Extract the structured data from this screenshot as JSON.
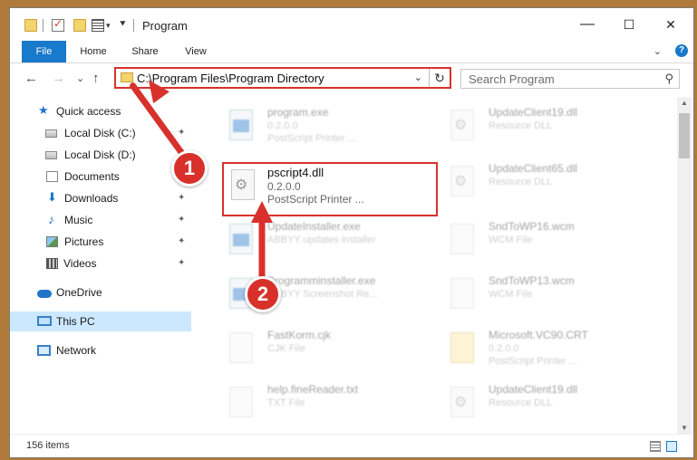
{
  "window": {
    "title": "Program",
    "controls": {
      "minimize": "—",
      "maximize": "☐",
      "close": "✕"
    }
  },
  "ribbon": {
    "tabs": [
      "File",
      "Home",
      "Share",
      "View"
    ],
    "collapse_glyph": "⌄",
    "help_glyph": "?"
  },
  "navigation": {
    "back_glyph": "←",
    "forward_glyph": "→",
    "recent_glyph": "⌄",
    "up_glyph": "↑",
    "address": "C:\\Program Files\\Program Directory",
    "dropdown_glyph": "⌄",
    "refresh_glyph": "↻",
    "search_placeholder": "Search Program",
    "search_glyph": "⚲"
  },
  "sidebar": {
    "items": [
      {
        "label": "Quick access",
        "icon": "star-icon"
      },
      {
        "label": "Local Disk (C:)",
        "icon": "drive-icon",
        "pinned": true
      },
      {
        "label": "Local Disk (D:)",
        "icon": "drive-icon",
        "pinned": true
      },
      {
        "label": "Documents",
        "icon": "documents-icon",
        "pinned": true
      },
      {
        "label": "Downloads",
        "icon": "download-icon",
        "pinned": true
      },
      {
        "label": "Music",
        "icon": "music-icon",
        "pinned": true
      },
      {
        "label": "Pictures",
        "icon": "pictures-icon",
        "pinned": true
      },
      {
        "label": "Videos",
        "icon": "videos-icon",
        "pinned": true
      },
      {
        "label": "OneDrive",
        "icon": "cloud-icon"
      },
      {
        "label": "This PC",
        "icon": "computer-icon",
        "selected": true
      },
      {
        "label": "Network",
        "icon": "network-icon"
      }
    ],
    "pin_glyph": "📌"
  },
  "files": [
    {
      "name": "program.exe",
      "line1": "0.2.0.0",
      "line2": "PostScript Printer ...",
      "icon": "exe-icon"
    },
    {
      "name": "UpdateClient19.dll",
      "line1": "Resource DLL",
      "line2": "",
      "icon": "dll-icon"
    },
    {
      "name": "pscript4.dll",
      "line1": "0.2.0.0",
      "line2": "PostScript Printer ...",
      "icon": "dll-icon"
    },
    {
      "name": "UpdateClient65.dll",
      "line1": "Resource DLL",
      "line2": "",
      "icon": "dll-icon"
    },
    {
      "name": "UpdateInstaller.exe",
      "line1": "ABBYY updates installer",
      "line2": "",
      "icon": "exe-icon"
    },
    {
      "name": "SndToWP16.wcm",
      "line1": "WCM File",
      "line2": "",
      "icon": "file-icon"
    },
    {
      "name": "Programminstaller.exe",
      "line1": "ABBYY Screenshot Re...",
      "line2": "",
      "icon": "exe-icon"
    },
    {
      "name": "SndToWP13.wcm",
      "line1": "WCM File",
      "line2": "",
      "icon": "file-icon"
    },
    {
      "name": "FastKorm.cjk",
      "line1": "CJK File",
      "line2": "",
      "icon": "file-icon"
    },
    {
      "name": "Microsoft.VC90.CRT",
      "line1": "0.2.0.0",
      "line2": "PostScript Printer ...",
      "icon": "folder-file-icon"
    },
    {
      "name": "help.fineReader.txt",
      "line1": "TXT File",
      "line2": "",
      "icon": "file-icon"
    },
    {
      "name": "UpdateClient19.dll",
      "line1": "Resource DLL",
      "line2": "",
      "icon": "dll-icon"
    }
  ],
  "highlighted_file_index": 2,
  "status": {
    "item_count": "156 items"
  },
  "callouts": [
    {
      "label": "1"
    },
    {
      "label": "2"
    }
  ],
  "colors": {
    "accent": "#1979ca",
    "callout_red": "#d8312c",
    "selection": "#cce8ff"
  }
}
